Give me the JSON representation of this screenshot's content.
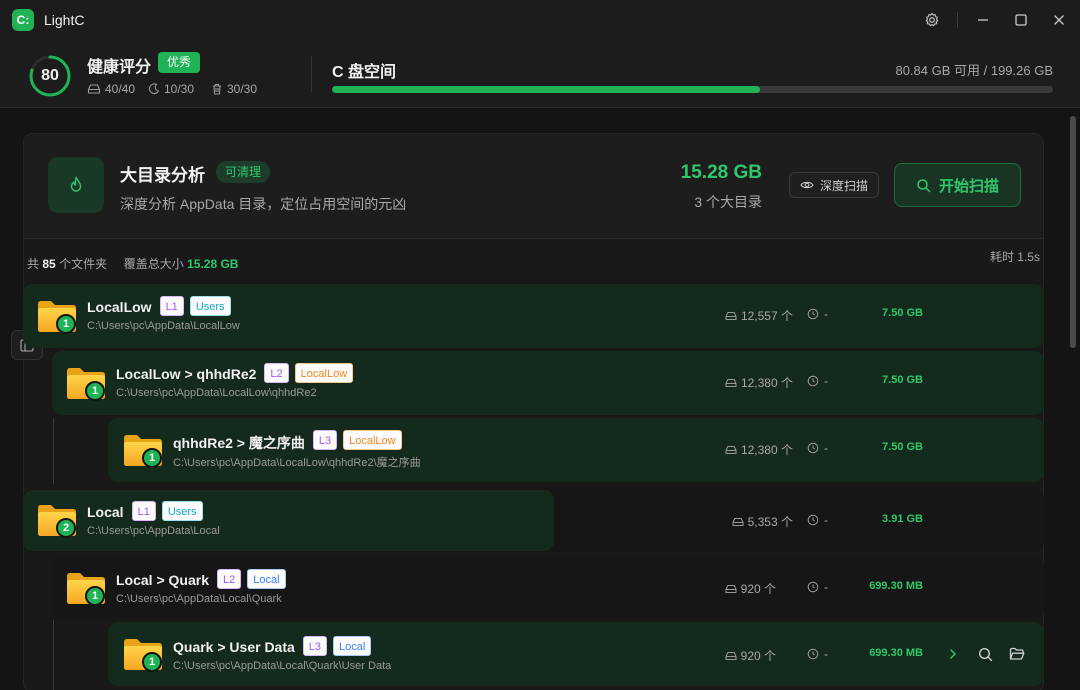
{
  "app": {
    "logo_text": "C:",
    "name": "LightC"
  },
  "window": {
    "icons": [
      "gear-icon",
      "minimize-icon",
      "maximize-icon",
      "close-icon"
    ]
  },
  "health": {
    "score": "80",
    "score_fraction": 0.8,
    "title": "健康评分",
    "badge": "优秀",
    "stats": [
      {
        "icon": "drive-icon",
        "value": "40/40"
      },
      {
        "icon": "moon-icon",
        "value": "10/30"
      },
      {
        "icon": "trash-icon",
        "value": "30/30"
      }
    ]
  },
  "disk": {
    "title": "C 盘空间",
    "info": "80.84 GB 可用 / 199.26 GB",
    "used_fraction": 0.5943
  },
  "analysis": {
    "title": "大目录分析",
    "badge": "可清理",
    "description": "深度分析 AppData 目录，定位占用空间的元凶",
    "total": "15.28 GB",
    "count": "3 个大目录",
    "deep_scan_label": "深度扫描",
    "scan_label": "开始扫描"
  },
  "summary": {
    "prefix": "共",
    "folders": "85",
    "folders_suffix": "个文件夹",
    "size_label": "覆盖总大小",
    "size": "15.28 GB",
    "time": "耗时 1.5s"
  },
  "rows": [
    {
      "name": "LocalLow",
      "level": "L1",
      "tag": "Users",
      "path": "C:\\Users\\pc\\AppData\\LocalLow",
      "files": "12,557 个",
      "time": "-",
      "size": "7.50 GB",
      "badge": "1"
    },
    {
      "name": "LocalLow > qhhdRe2",
      "level": "L2",
      "tag": "LocalLow",
      "path": "C:\\Users\\pc\\AppData\\LocalLow\\qhhdRe2",
      "files": "12,380 个",
      "time": "-",
      "size": "7.50 GB",
      "badge": "1"
    },
    {
      "name": "qhhdRe2 > 魔之序曲",
      "level": "L3",
      "tag": "LocalLow",
      "path": "C:\\Users\\pc\\AppData\\LocalLow\\qhhdRe2\\魔之序曲",
      "files": "12,380 个",
      "time": "-",
      "size": "7.50 GB",
      "badge": "1"
    },
    {
      "name": "Local",
      "level": "L1",
      "tag": "Users",
      "path": "C:\\Users\\pc\\AppData\\Local",
      "files": "5,353 个",
      "time": "-",
      "size": "3.91 GB",
      "badge": "2"
    },
    {
      "name": "Local > Quark",
      "level": "L2",
      "tag": "Local",
      "path": "C:\\Users\\pc\\AppData\\Local\\Quark",
      "files": "920 个",
      "time": "-",
      "size": "699.30 MB",
      "badge": "1"
    },
    {
      "name": "Quark > User Data",
      "level": "L3",
      "tag": "Local",
      "path": "C:\\Users\\pc\\AppData\\Local\\Quark\\User Data",
      "files": "920 个",
      "time": "-",
      "size": "699.30 MB",
      "badge": "1"
    }
  ],
  "colors": {
    "accent": "#1fb356",
    "accent_text": "#2ec86a",
    "row_green": "#142a1c"
  }
}
